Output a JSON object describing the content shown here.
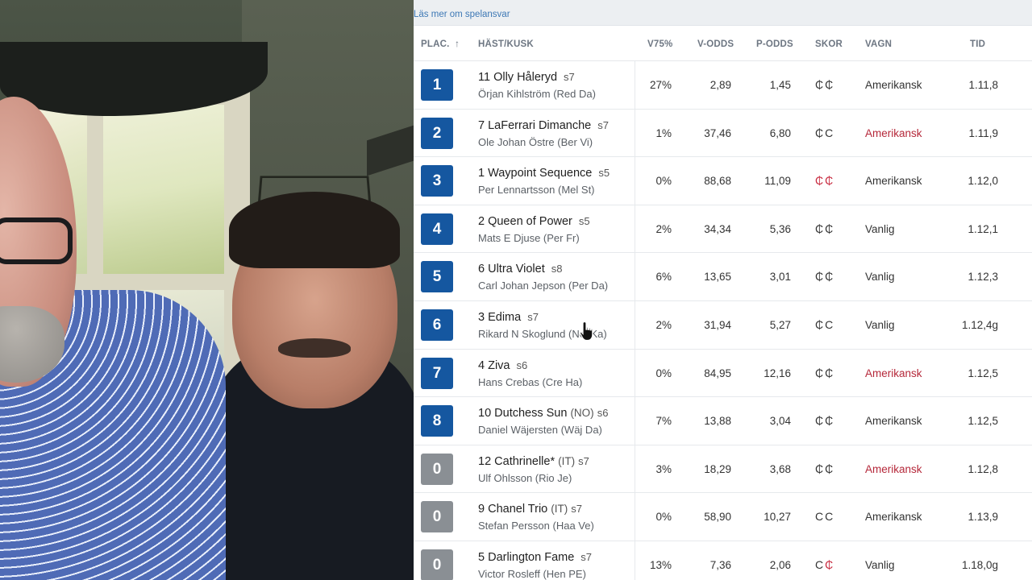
{
  "topbar": {
    "link": "Läs mer om spelansvar"
  },
  "headers": {
    "plac": "PLAC.",
    "sort_arrow": "↑",
    "horse": "HÄST/KUSK",
    "v75": "V75%",
    "vodds": "V-ODDS",
    "podds": "P-ODDS",
    "skor": "SKOR",
    "vagn": "VAGN",
    "tid": "TID"
  },
  "colors": {
    "place_win": "#1557a0",
    "place_out": "#8a8f94",
    "alert_red": "#c7283d"
  },
  "rows": [
    {
      "place": "1",
      "placed": true,
      "horse": "11 Olly Håleryd",
      "country": "",
      "age": "s7",
      "driver": "Örjan Kihlström (Red Da)",
      "v75": "27%",
      "vodds": "2,89",
      "podds": "1,45",
      "shoe1": "₵",
      "shoe1_red": false,
      "shoe2": "₵",
      "shoe2_red": false,
      "vagn": "Amerikansk",
      "vagn_red": false,
      "tid": "1.11,8"
    },
    {
      "place": "2",
      "placed": true,
      "horse": "7 LaFerrari Dimanche",
      "country": "",
      "age": "s7",
      "driver": "Ole Johan Östre (Ber Vi)",
      "v75": "1%",
      "vodds": "37,46",
      "podds": "6,80",
      "shoe1": "₵",
      "shoe1_red": false,
      "shoe2": "C",
      "shoe2_red": false,
      "vagn": "Amerikansk",
      "vagn_red": true,
      "tid": "1.11,9"
    },
    {
      "place": "3",
      "placed": true,
      "horse": "1 Waypoint Sequence",
      "country": "",
      "age": "s5",
      "driver": "Per Lennartsson (Mel St)",
      "v75": "0%",
      "vodds": "88,68",
      "podds": "11,09",
      "shoe1": "₵",
      "shoe1_red": true,
      "shoe2": "₵",
      "shoe2_red": true,
      "vagn": "Amerikansk",
      "vagn_red": false,
      "tid": "1.12,0"
    },
    {
      "place": "4",
      "placed": true,
      "horse": "2 Queen of Power",
      "country": "",
      "age": "s5",
      "driver": "Mats E Djuse (Per Fr)",
      "v75": "2%",
      "vodds": "34,34",
      "podds": "5,36",
      "shoe1": "₵",
      "shoe1_red": false,
      "shoe2": "₵",
      "shoe2_red": false,
      "vagn": "Vanlig",
      "vagn_red": false,
      "tid": "1.12,1"
    },
    {
      "place": "5",
      "placed": true,
      "horse": "6 Ultra Violet",
      "country": "",
      "age": "s8",
      "driver": "Carl Johan Jepson (Per Da)",
      "v75": "6%",
      "vodds": "13,65",
      "podds": "3,01",
      "shoe1": "₵",
      "shoe1_red": false,
      "shoe2": "₵",
      "shoe2_red": false,
      "vagn": "Vanlig",
      "vagn_red": false,
      "tid": "1.12,3"
    },
    {
      "place": "6",
      "placed": true,
      "horse": "3 Edima",
      "country": "",
      "age": "s7",
      "driver": "Rikard N Skoglund (Nel Ka)",
      "v75": "2%",
      "vodds": "31,94",
      "podds": "5,27",
      "shoe1": "₵",
      "shoe1_red": false,
      "shoe2": "C",
      "shoe2_red": false,
      "vagn": "Vanlig",
      "vagn_red": false,
      "tid": "1.12,4g"
    },
    {
      "place": "7",
      "placed": true,
      "horse": "4 Ziva",
      "country": "",
      "age": "s6",
      "driver": "Hans Crebas (Cre Ha)",
      "v75": "0%",
      "vodds": "84,95",
      "podds": "12,16",
      "shoe1": "₵",
      "shoe1_red": false,
      "shoe2": "₵",
      "shoe2_red": false,
      "vagn": "Amerikansk",
      "vagn_red": true,
      "tid": "1.12,5"
    },
    {
      "place": "8",
      "placed": true,
      "horse": "10 Dutchess Sun",
      "country": "(NO)",
      "age": "s6",
      "driver": "Daniel Wäjersten (Wäj Da)",
      "v75": "7%",
      "vodds": "13,88",
      "podds": "3,04",
      "shoe1": "₵",
      "shoe1_red": false,
      "shoe2": "₵",
      "shoe2_red": false,
      "vagn": "Amerikansk",
      "vagn_red": false,
      "tid": "1.12,5"
    },
    {
      "place": "0",
      "placed": false,
      "horse": "12 Cathrinelle*",
      "country": "(IT)",
      "age": "s7",
      "driver": "Ulf Ohlsson (Rio Je)",
      "v75": "3%",
      "vodds": "18,29",
      "podds": "3,68",
      "shoe1": "₵",
      "shoe1_red": false,
      "shoe2": "₵",
      "shoe2_red": false,
      "vagn": "Amerikansk",
      "vagn_red": true,
      "tid": "1.12,8"
    },
    {
      "place": "0",
      "placed": false,
      "horse": "9 Chanel Trio",
      "country": "(IT)",
      "age": "s7",
      "driver": "Stefan Persson (Haa Ve)",
      "v75": "0%",
      "vodds": "58,90",
      "podds": "10,27",
      "shoe1": "C",
      "shoe1_red": false,
      "shoe2": "C",
      "shoe2_red": false,
      "vagn": "Amerikansk",
      "vagn_red": false,
      "tid": "1.13,9"
    },
    {
      "place": "0",
      "placed": false,
      "horse": "5 Darlington Fame",
      "country": "",
      "age": "s7",
      "driver": "Victor Rosleff (Hen PE)",
      "v75": "13%",
      "vodds": "7,36",
      "podds": "2,06",
      "shoe1": "C",
      "shoe1_red": false,
      "shoe2": "₵",
      "shoe2_red": true,
      "vagn": "Vanlig",
      "vagn_red": false,
      "tid": "1.18,0g"
    }
  ]
}
